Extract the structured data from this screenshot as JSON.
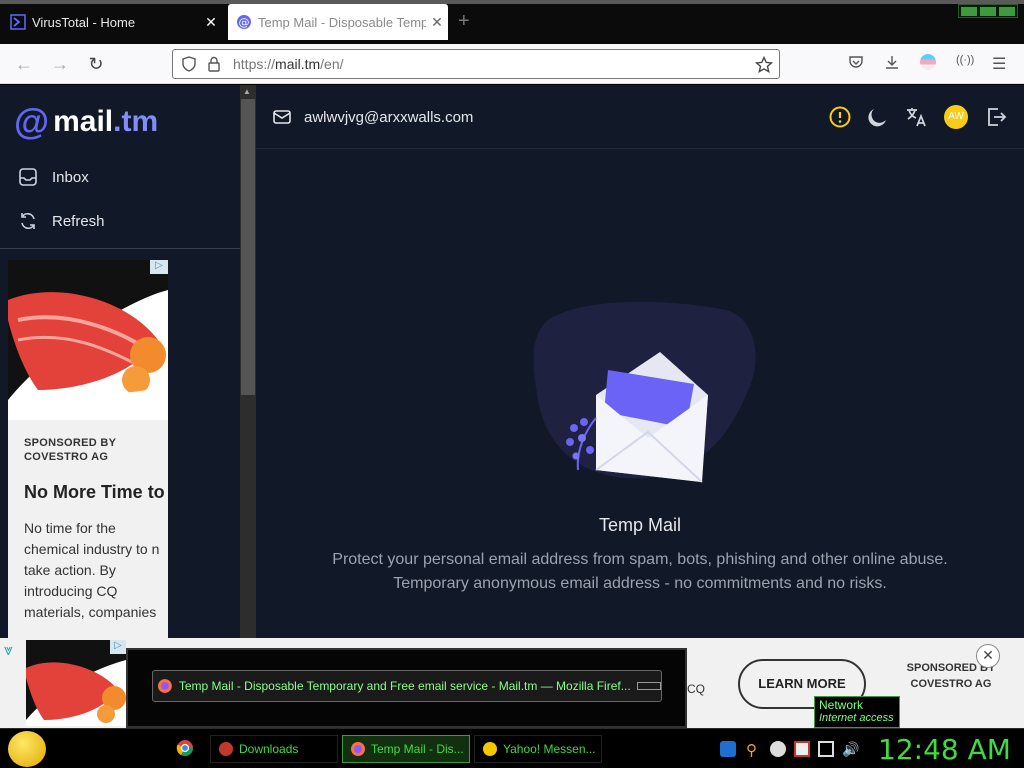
{
  "browser": {
    "tabs": [
      {
        "title": "VirusTotal - Home",
        "active": false
      },
      {
        "title": "Temp Mail - Disposable Tempo",
        "active": true
      }
    ],
    "url_prefix": "https://",
    "url_host": "mail.tm",
    "url_path": "/en/"
  },
  "site": {
    "logo_name": "mail",
    "logo_tld": ".tm",
    "sidebar": [
      {
        "label": "Inbox",
        "icon": "inbox-icon"
      },
      {
        "label": "Refresh",
        "icon": "refresh-icon"
      }
    ],
    "email_address": "awlwvjvg@arxxwalls.com",
    "avatar_initials": "AW",
    "hero_title": "Temp Mail",
    "hero_line1": "Protect your personal email address from spam, bots, phishing and other online abuse.",
    "hero_line2": "Temporary anonymous email address - no commitments and no risks."
  },
  "side_ad": {
    "sponsor": "SPONSORED BY COVESTRO AG",
    "headline": "No More Time to Waste.",
    "body": [
      "No time for the",
      "chemical industry to n",
      "take action. By",
      "introducing CQ",
      "materials, companies"
    ]
  },
  "bottom_ad": {
    "cq_text": "CQ",
    "cta": "LEARN MORE",
    "sponsor": "SPONSORED BY COVESTRO AG"
  },
  "preview": {
    "title": "Temp Mail - Disposable Temporary and Free email service - Mail.tm — Mozilla Firef..."
  },
  "network_tooltip": {
    "title": "Network",
    "status": "Internet access"
  },
  "taskbar": {
    "items": [
      {
        "label": "Downloads"
      },
      {
        "label": "Temp Mail - Dis..."
      },
      {
        "label": "Yahoo! Messen..."
      }
    ],
    "clock": "12:48 AM"
  },
  "colors": {
    "accent": "#6366f1",
    "bg": "#111827",
    "taskbar_text": "#3fdc3f"
  }
}
